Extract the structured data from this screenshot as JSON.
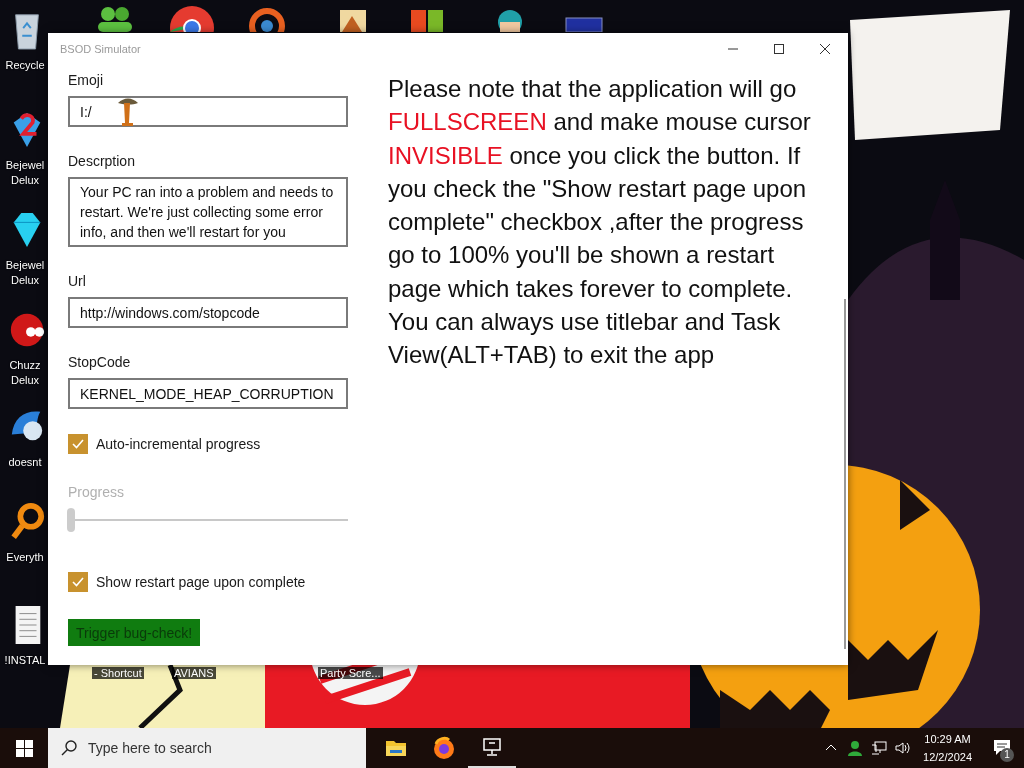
{
  "desktop": {
    "left_icons": [
      {
        "kind": "recycle-bin",
        "lines": [
          "Recycle"
        ]
      },
      {
        "kind": "gem-two",
        "lines": [
          "Bejewel",
          "Delux"
        ]
      },
      {
        "kind": "gem",
        "lines": [
          "Bejewel",
          "Delux"
        ]
      },
      {
        "kind": "creature",
        "lines": [
          "Chuzz",
          "Delux"
        ]
      },
      {
        "kind": "bird",
        "lines": [
          "doesnt"
        ]
      },
      {
        "kind": "magnifier",
        "lines": [
          "Everyth"
        ]
      },
      {
        "kind": "document",
        "lines": [
          "!INSTAL"
        ]
      }
    ],
    "top_icons": [
      {
        "kind": "people"
      },
      {
        "kind": "browser"
      },
      {
        "kind": "ring"
      },
      {
        "kind": "picture-file"
      },
      {
        "kind": "tiles"
      },
      {
        "kind": "character"
      },
      {
        "kind": "screen"
      }
    ],
    "bottom_labels": [
      "- Shortcut",
      "AVIANS",
      "Party Scre..."
    ]
  },
  "window": {
    "title": "BSOD Simulator",
    "fields": [
      {
        "kind": "emoji",
        "label": "Emoji",
        "value": "I:/"
      },
      {
        "kind": "textarea",
        "label": "Descrption",
        "value": "Your PC ran into a problem and needs to restart. We're just collecting some error info, and then we'll restart for you"
      },
      {
        "kind": "input",
        "label": "Url",
        "value": "http://windows.com/stopcode"
      },
      {
        "kind": "input",
        "label": "StopCode",
        "value": "KERNEL_MODE_HEAP_CORRUPTION"
      }
    ],
    "auto_progress": {
      "label": "Auto-incremental progress",
      "checked": true
    },
    "progress": {
      "label": "Progress",
      "level": 0,
      "disabled": true
    },
    "show_restart": {
      "label": "Show restart page upon complete",
      "checked": true
    },
    "button": {
      "label": "Trigger bug-check!"
    },
    "note": [
      {
        "text": "Please note that the application will go ",
        "highlight": false
      },
      {
        "text": "FULLSCREEN",
        "highlight": true
      },
      {
        "text": " and make mouse cursor ",
        "highlight": false
      },
      {
        "text": "INVISIBLE",
        "highlight": true
      },
      {
        "text": " once you click the button. If you check the \"Show restart page upon complete\" checkbox ,after the progress go to 100% you'll be shown a restart page which takes forever to complete. You can always use titlebar and Task View(ALT+TAB) to exit the app",
        "highlight": false
      }
    ]
  },
  "taskbar": {
    "search": {
      "placeholder": "Type here to search"
    },
    "pinned": [
      {
        "kind": "folder",
        "active": false
      },
      {
        "kind": "firefox",
        "active": false
      },
      {
        "kind": "computer",
        "active": true
      }
    ],
    "time": "10:29 AM",
    "date": "12/2/2024",
    "notifications": "1"
  }
}
